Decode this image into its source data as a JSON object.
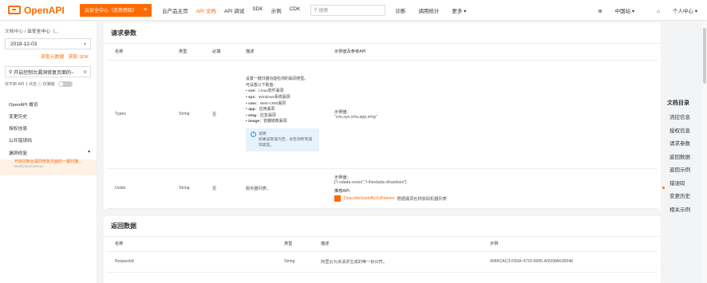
{
  "header": {
    "logo": "OpenAPI",
    "product_button": "云安全中心（态势感知）",
    "nav": [
      "云产品主页",
      "API 文档",
      "API 调试",
      "SDK",
      "示例",
      "CDK"
    ],
    "search_placeholder": "搜索",
    "nav2": [
      "诊断",
      "调用统计",
      "更多 ▾"
    ],
    "region": "中国站 ▾",
    "user": "个人中心 ▾"
  },
  "sidebar": {
    "breadcrumb_root": "文档中心",
    "breadcrumb_sep": "/",
    "breadcrumb_leaf": "云安全中心（...",
    "version": "2018-12-03",
    "link_metadata": "获取元数据",
    "link_sdk": "获取 SDK",
    "filter_value": "开启控制台漏洞修复页面的~",
    "filter_options": "仅不到 API 1 点击 ⓘ 仅弹窗",
    "items": [
      "OpenAPI 概览",
      "变更历史",
      "授权信息",
      "公共错误码",
      "漏洞修复"
    ],
    "selected_title": "开启控制台漏洞修复页面的一键扫描...",
    "selected_sub": "ModifyStartVulScan"
  },
  "request": {
    "title": "请求参数",
    "columns": [
      "名称",
      "类型",
      "必填",
      "描述",
      "示例值及参考API"
    ],
    "types_row": {
      "name": "Types",
      "type": "String",
      "required": "否",
      "desc_intro": "设置一键扫描功能检测的漏洞类型。",
      "desc_intro2": "可设置以下取值：",
      "options": [
        {
          "k": "cve",
          "v": "：Linux软件漏洞"
        },
        {
          "k": "sys",
          "v": "：Windows系统漏洞"
        },
        {
          "k": "cms",
          "v": "：Web-CMS漏洞"
        },
        {
          "k": "app",
          "v": "：应用漏洞"
        },
        {
          "k": "emg",
          "v": "：应急漏洞"
        },
        {
          "k": "image",
          "v": "：容器镜像漏洞"
        }
      ],
      "note_title": "说明",
      "note_body": "如果该取值为空，会检测所有漏洞类型。",
      "example_label": "示例值：",
      "example_value": "\"cve,sys,cms,app,emg\""
    },
    "uuids_row": {
      "name": "Uuids",
      "type": "String",
      "required": "否",
      "desc": "服务器列表。",
      "example_label": "示例值：",
      "example_value": "[\"i-sdada-xxxxx\",\"i-ifsedada-sfsasdxxx\"]",
      "ref_label": "推荐API:",
      "ref_api": "DescribeUuidsByVulNames",
      "ref_desc": "根据漏洞名称获取机器列表"
    }
  },
  "response": {
    "title": "返回数据",
    "columns": [
      "名称",
      "类型",
      "描述",
      "示例"
    ],
    "row": {
      "name": "RequestId",
      "type": "String",
      "desc": "阿里云为该请求生成的唯一标识符。",
      "example": "4066CAC3-F83A-4729-9995-A5558A61B546"
    }
  },
  "toc": {
    "title": "文档目录",
    "items": [
      "流控信息",
      "授权信息",
      "请求参数",
      "返回数据",
      "返回示例",
      "错误码",
      "变更历史",
      "相关示例"
    ]
  }
}
